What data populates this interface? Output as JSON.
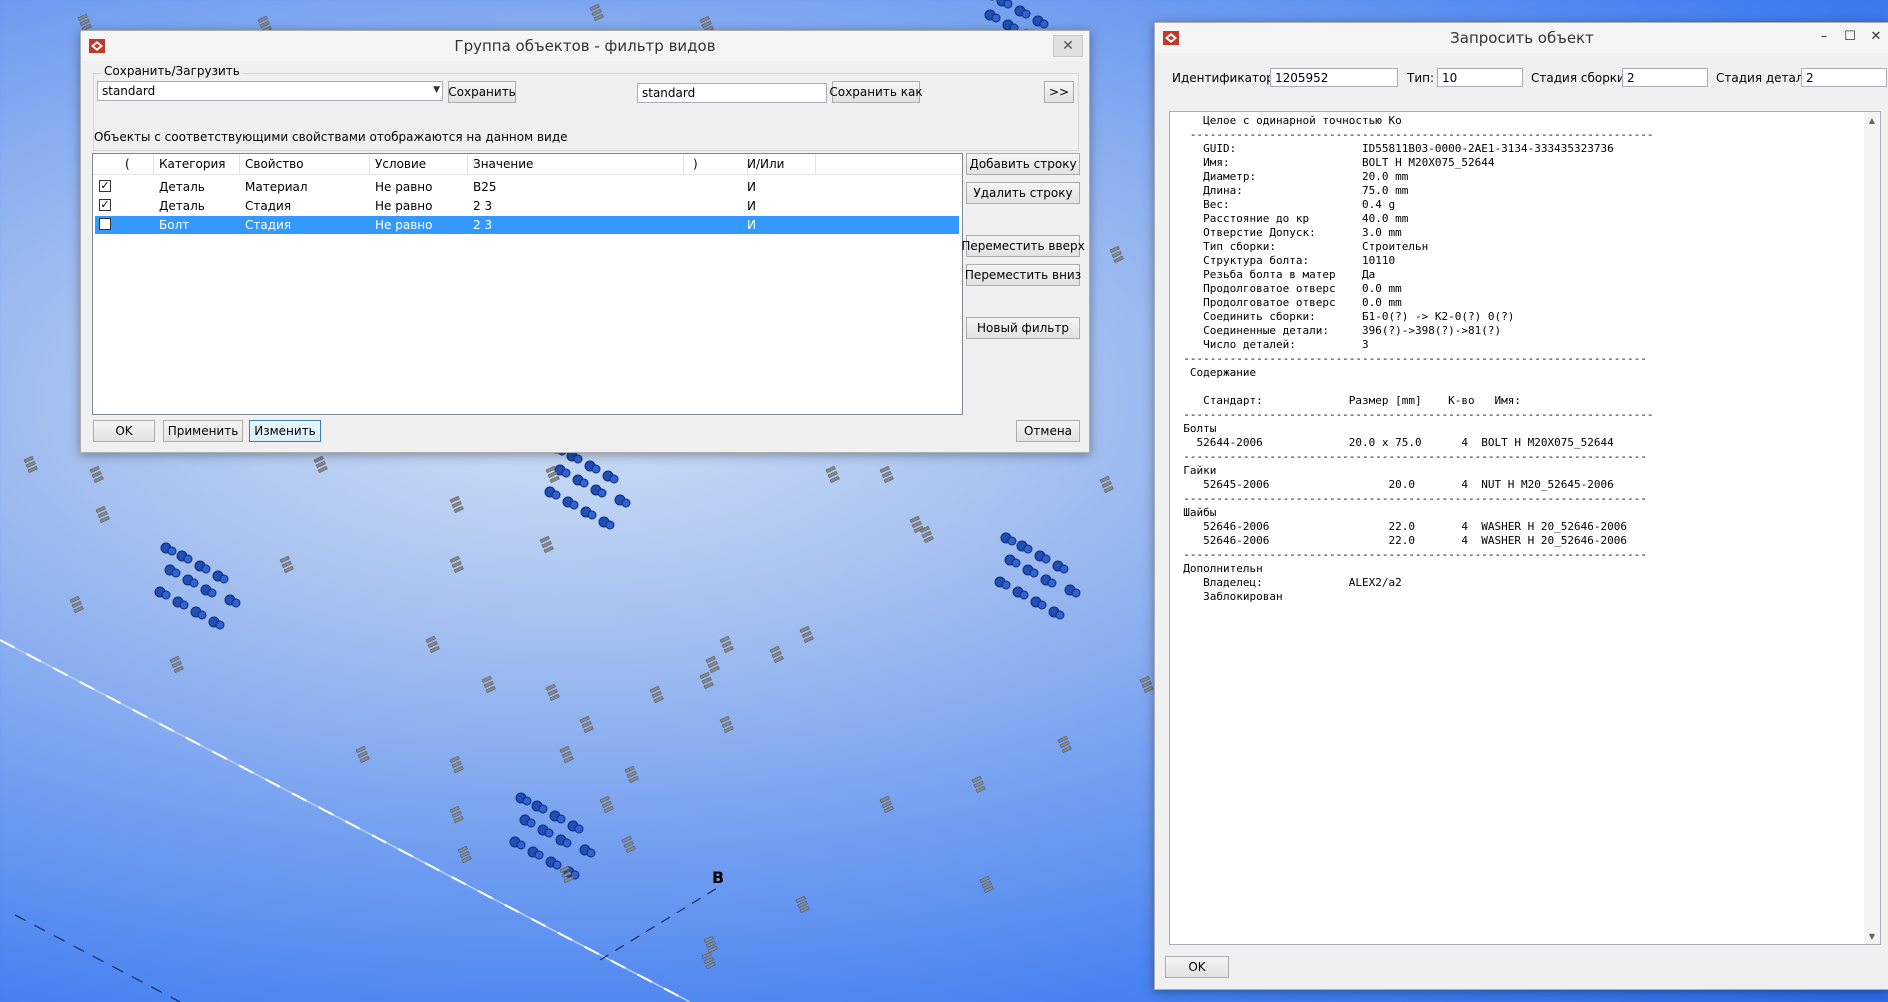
{
  "viewport": {
    "marker_label": "B"
  },
  "filter_dialog": {
    "title": "Группа объектов - фильтр видов",
    "save_load_group": "Сохранить/Загрузить",
    "load_combo_value": "standard",
    "save_button": "Сохранить",
    "save_as_field": "standard",
    "save_as_button": "Сохранить как",
    "expand_button": ">>",
    "info_text": "Объекты с соответствующими свойствами отображаются на данном виде",
    "columns": {
      "open": "(",
      "category": "Категория",
      "property": "Свойство",
      "condition": "Условие",
      "value": "Значение",
      "close": ")",
      "andor": "И/Или"
    },
    "rows": [
      {
        "checked": true,
        "check_mark": "✓",
        "category": "Деталь",
        "property": "Материал",
        "condition": "Не равно",
        "value": "B25",
        "andor": "И"
      },
      {
        "checked": true,
        "check_mark": "✓",
        "category": "Деталь",
        "property": "Стадия",
        "condition": "Не равно",
        "value": "2 3",
        "andor": "И"
      },
      {
        "checked": false,
        "check_mark": "",
        "category": "Болт",
        "property": "Стадия",
        "condition": "Не равно",
        "value": "2 3",
        "andor": "И"
      }
    ],
    "side_buttons": {
      "add_row": "Добавить строку",
      "delete_row": "Удалить строку",
      "move_up": "Переместить вверх",
      "move_down": "Переместить вниз",
      "new_filter": "Новый фильтр"
    },
    "bottom_buttons": {
      "ok": "OK",
      "apply": "Применить",
      "modify": "Изменить",
      "cancel": "Отмена"
    }
  },
  "inquire_dialog": {
    "title": "Запросить объект",
    "fields": {
      "id_label": "Идентификатор:",
      "id_value": "1205952",
      "type_label": "Тип:",
      "type_value": "10",
      "assembly_stage_label": "Стадия сборки:",
      "assembly_stage_value": "2",
      "part_stage_label": "Стадия детали:",
      "part_stage_value": "2"
    },
    "report_lines": [
      "     Целое с одинарной точностью Ко",
      "   ----------------------------------------------------------------------",
      "     GUID:                   ID55811B03-0000-2AE1-3134-333435323736",
      "     Имя:                    BOLT H M20X075_52644",
      "     Диаметр:                20.0 mm",
      "     Длина:                  75.0 mm",
      "     Вес:                    0.4 g",
      "     Расстояние до кр        40.0 mm",
      "     Отверстие Допуск:       3.0 mm",
      "     Тип сборки:             Строительн",
      "     Структура болта:        10110",
      "     Резьба болта в матер    Да",
      "     Продолговатое отверс    0.0 mm",
      "     Продолговатое отверс    0.0 mm",
      "     Соединить сборки:       Б1-0(?) -> К2-0(?) 0(?)",
      "     Соединенные детали:     396(?)->398(?)->81(?)",
      "     Число деталей:          3",
      "  ----------------------------------------------------------------------",
      "   Содержание",
      "",
      "     Стандарт:             Размер [mm]    К-во   Имя:",
      "  -----------------------------------------------------------------------",
      "  Болты",
      "    52644-2006             20.0 x 75.0      4  BOLT H M20X075_52644",
      "  ----------------------------------------------------------------------",
      "  Гайки",
      "     52645-2006                  20.0       4  NUT H M20_52645-2006",
      "  ----------------------------------------------------------------------",
      "  Шайбы",
      "     52646-2006                  22.0       4  WASHER H 20_52646-2006",
      "     52646-2006                  22.0       4  WASHER H 20_52646-2006",
      "  ----------------------------------------------------------------------",
      "  Дополнительн",
      "     Владелец:             ALEX2/a2",
      "     Заблокирован"
    ],
    "ok_button": "OK"
  }
}
